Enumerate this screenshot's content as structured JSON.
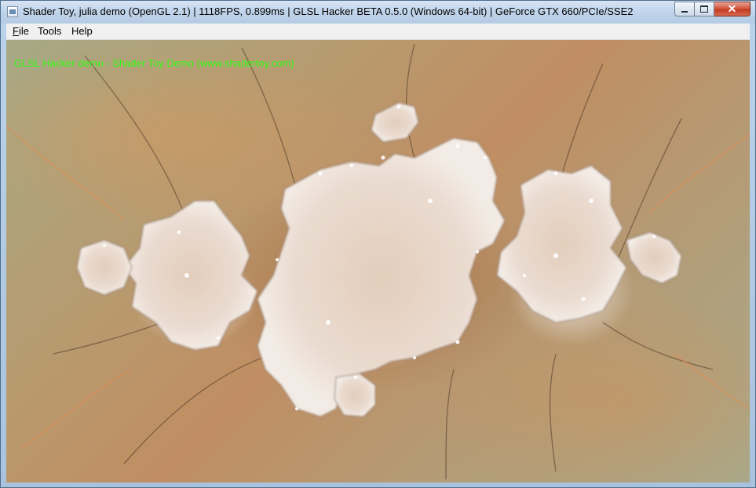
{
  "window": {
    "title": "Shader Toy, julia demo (OpenGL 2.1) | 1118FPS, 0.899ms | GLSL Hacker BETA 0.5.0 (Windows 64-bit) | GeForce GTX 660/PCIe/SSE2",
    "icon": "app-window-icon",
    "controls": {
      "minimize_icon": "minimize-icon",
      "maximize_icon": "maximize-icon",
      "close_icon": "close-icon"
    }
  },
  "menu": {
    "items": [
      {
        "mnemonic": "F",
        "rest": "ile"
      },
      {
        "mnemonic": "",
        "rest": "Tools"
      },
      {
        "mnemonic": "",
        "rest": "Help"
      }
    ]
  },
  "viewport": {
    "overlay_text": "GLSL Hacker demo - Shader Toy Demo (www.shadertoy.com)",
    "overlay_color": "#33ff14"
  }
}
